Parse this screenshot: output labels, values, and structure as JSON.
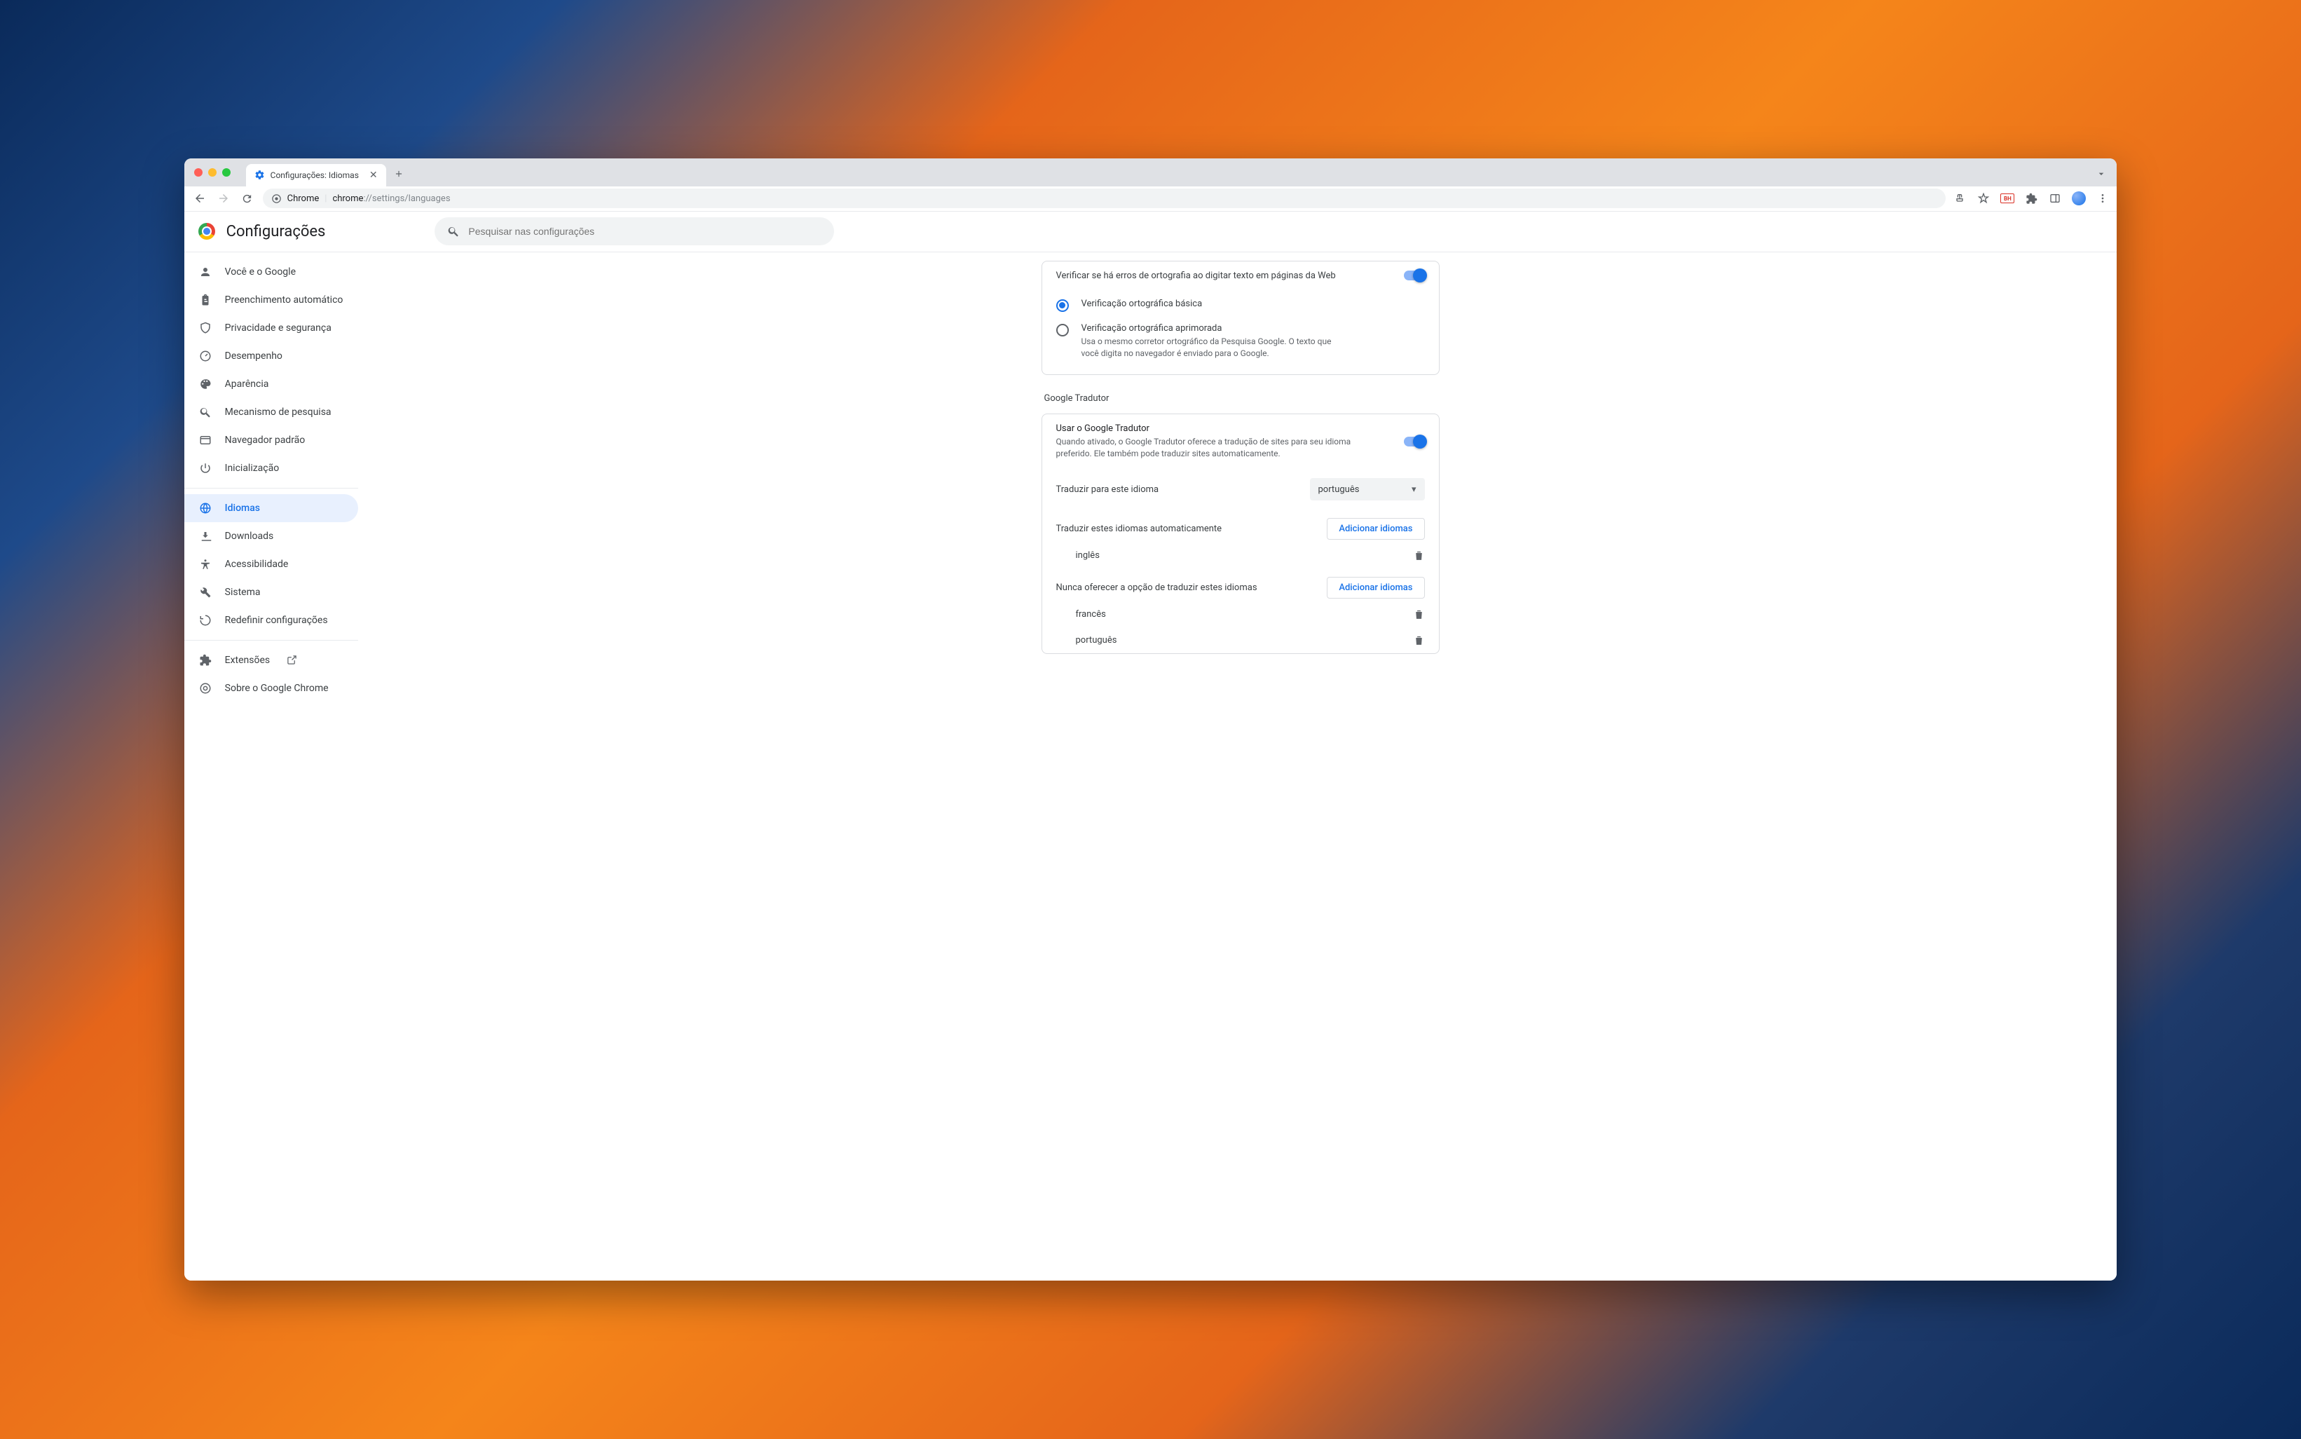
{
  "tab": {
    "title": "Configurações: Idiomas"
  },
  "address": {
    "prefix": "Chrome",
    "scheme": "chrome",
    "path": "://settings/",
    "page": "languages"
  },
  "header": {
    "app": "Configurações",
    "search_placeholder": "Pesquisar nas configurações"
  },
  "sidebar": {
    "items": [
      {
        "label": "Você e o Google",
        "icon": "person-icon"
      },
      {
        "label": "Preenchimento automático",
        "icon": "clipboard-icon"
      },
      {
        "label": "Privacidade e segurança",
        "icon": "shield-icon"
      },
      {
        "label": "Desempenho",
        "icon": "speed-icon"
      },
      {
        "label": "Aparência",
        "icon": "palette-icon"
      },
      {
        "label": "Mecanismo de pesquisa",
        "icon": "search-icon"
      },
      {
        "label": "Navegador padrão",
        "icon": "window-icon"
      },
      {
        "label": "Inicialização",
        "icon": "power-icon"
      }
    ],
    "items2": [
      {
        "label": "Idiomas",
        "icon": "globe-icon",
        "active": true
      },
      {
        "label": "Downloads",
        "icon": "download-icon"
      },
      {
        "label": "Acessibilidade",
        "icon": "accessibility-icon"
      },
      {
        "label": "Sistema",
        "icon": "wrench-icon"
      },
      {
        "label": "Redefinir configurações",
        "icon": "reset-icon"
      }
    ],
    "footer": [
      {
        "label": "Extensões",
        "icon": "puzzle-icon",
        "external": true
      },
      {
        "label": "Sobre o Google Chrome",
        "icon": "chrome-icon"
      }
    ]
  },
  "spellcheck": {
    "title": "Verificar se há erros de ortografia ao digitar texto em páginas da Web",
    "basic_label": "Verificação ortográfica básica",
    "enhanced_label": "Verificação ortográfica aprimorada",
    "enhanced_desc": "Usa o mesmo corretor ortográfico da Pesquisa Google. O texto que você digita no navegador é enviado para o Google."
  },
  "translate": {
    "section_title": "Google Tradutor",
    "use_title": "Usar o Google Tradutor",
    "use_desc": "Quando ativado, o Google Tradutor oferece a tradução de sites para seu idioma preferido. Ele também pode traduzir sites automaticamente.",
    "target_label": "Traduzir para este idioma",
    "target_value": "português",
    "auto_label": "Traduzir estes idiomas automaticamente",
    "never_label": "Nunca oferecer a opção de traduzir estes idiomas",
    "add_button": "Adicionar idiomas",
    "auto_list": [
      {
        "name": "inglês"
      }
    ],
    "never_list": [
      {
        "name": "francês"
      },
      {
        "name": "português"
      }
    ]
  },
  "toolbar_ext_badge": "BH"
}
